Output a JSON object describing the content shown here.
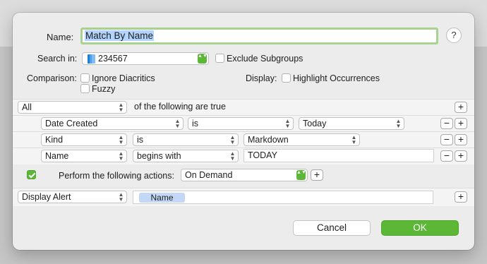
{
  "dialog": {
    "name_label": "Name:",
    "name_value": "Match By Name",
    "help_label": "?",
    "search_in_label": "Search in:",
    "search_in_value": "234567",
    "exclude_subgroups_label": "Exclude Subgroups",
    "comparison_label": "Comparison:",
    "ignore_diacritics_label": "Ignore Diacritics",
    "fuzzy_label": "Fuzzy",
    "display_label": "Display:",
    "highlight_occurrences_label": "Highlight Occurrences"
  },
  "conditions": {
    "match_mode": "All",
    "match_suffix": "of the following are true",
    "rows": [
      {
        "field": "Date Created",
        "operator": "is",
        "value": "Today"
      },
      {
        "field": "Kind",
        "operator": "is",
        "value": "Markdown"
      },
      {
        "field": "Name",
        "operator": "begins with",
        "value": "TODAY"
      }
    ]
  },
  "actions": {
    "perform_label": "Perform the following actions:",
    "perform_checked": true,
    "trigger_value": "On Demand",
    "action_type": "Display Alert",
    "token_label": "Name"
  },
  "buttons": {
    "cancel_label": "Cancel",
    "ok_label": "OK",
    "plus": "+",
    "minus": "−",
    "up": "▲",
    "down": "▼"
  },
  "colors": {
    "accent_green": "#5cb736",
    "selection_blue": "#b3d4fc",
    "name_field_border": "#a8d28f"
  }
}
